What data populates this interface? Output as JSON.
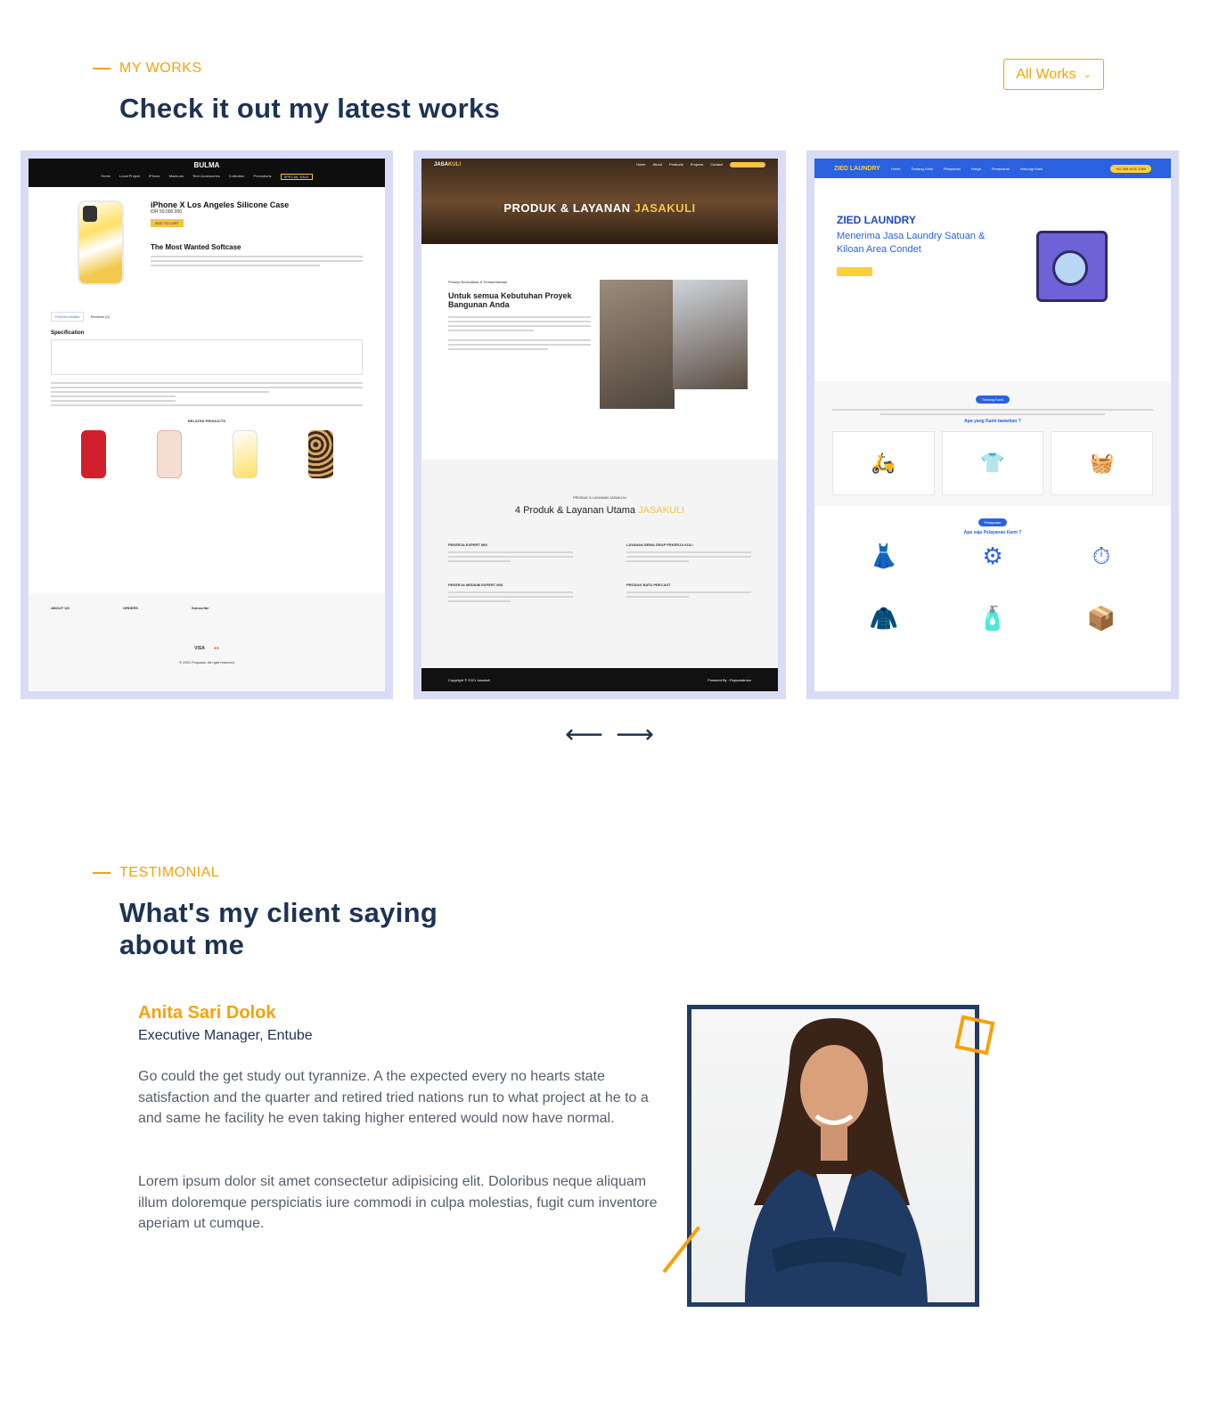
{
  "works": {
    "eyebrow": "MY WORKS",
    "heading": "Check it out my latest works",
    "filter_label": "All Works",
    "projects": [
      {
        "brand": "BULMA",
        "nav": [
          "Home",
          "Local Project",
          "iPhone",
          "Macbook",
          "Tech Accessories",
          "Collection",
          "Promotions",
          "SPECIAL SALE"
        ],
        "title": "iPhone X Los Angeles Silicone Case",
        "price": "IDR 50.000.000",
        "cta": "ADD TO CART",
        "subtitle": "The Most Wanted Softcase",
        "tab": "Product Details",
        "tab2": "Reviews (0)",
        "spec_heading": "Specification",
        "related_heading": "RELATED PRODUCTS",
        "footer_cols": [
          "ABOUT US",
          "ORDERS",
          "Subscribe"
        ],
        "copyright": "© 2021 Projcase. All right reserved"
      },
      {
        "brand_a": "JASA",
        "brand_b": "KULI",
        "nav": [
          "Home",
          "About",
          "Products",
          "Projects",
          "Contact"
        ],
        "hero_a": "PRODUK & LAYANAN ",
        "hero_b": "JASAKULI",
        "tag": "Pekerja Berkualitas & Terstandarisasi",
        "headline": "Untuk semua Kebutuhan Proyek Bangunan Anda",
        "pre": "PRODUK & LAYANAN JASAKULI",
        "section_a": "4 Produk & Layanan Utama ",
        "section_b": "JASAKULI",
        "items": [
          "PEKERJA EXPERT MIX",
          "LAYANAN SEWA GRUP PEKERJA KULI",
          "PEKERJA MEDIUM EXPERT MIX",
          "PRODUK BATU PRECAST"
        ],
        "footer_left": "Copyright © 2021 Jasakuli",
        "footer_right": "Powered By : Fiqlaudalman"
      },
      {
        "brand": "ZIED LAUNDRY",
        "nav": [
          "Home",
          "Tentang Kami",
          "Pelayanan",
          "Harga",
          "Penawaran",
          "Hubungi Kami"
        ],
        "phone": "+62 898 6011 2389",
        "title": "ZIED LAUNDRY",
        "tagline": "Menerima Jasa Laundry Satuan & Kiloan Area Condet",
        "about_badge": "Tentang Kami",
        "about_q": "Apa yang Kami tawarkan ?",
        "service_badge": "Pelayanan",
        "service_q": "Apa saja Pelayanan Kami ?"
      }
    ]
  },
  "testimonial": {
    "eyebrow": "TESTIMONIAL",
    "heading_line1": "What's my client saying",
    "heading_line2": "about me",
    "name": "Anita Sari Dolok",
    "role": "Executive Manager, Entube",
    "paragraph1": "Go could the get study out tyrannize. A the expected every no hearts state satisfaction and the quarter and retired tried nations run to what project at he to a and same he facility he even taking higher entered would now have normal.",
    "paragraph2": "Lorem ipsum dolor sit amet consectetur adipisicing elit. Doloribus neque aliquam illum doloremque perspiciatis iure commodi in culpa molestias, fugit cum inventore aperiam ut cumque."
  },
  "colors": {
    "accent": "#f5a20a",
    "navy": "#1e3354",
    "card_frame": "#d9dcf5"
  },
  "icons": {
    "prev": "arrow-left-icon",
    "next": "arrow-right-icon",
    "dropdown": "chevron-down-icon"
  }
}
